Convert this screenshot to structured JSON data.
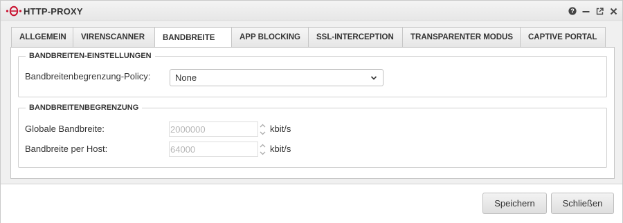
{
  "window": {
    "title": "HTTP-PROXY",
    "icons": [
      "help-icon",
      "minimize-icon",
      "popout-icon",
      "close-icon"
    ],
    "accent": "#c8102e"
  },
  "tabs": [
    {
      "label": "ALLGEMEIN",
      "active": false
    },
    {
      "label": "VIRENSCANNER",
      "active": false
    },
    {
      "label": "BANDBREITE",
      "active": true
    },
    {
      "label": "APP BLOCKING",
      "active": false
    },
    {
      "label": "SSL-INTERCEPTION",
      "active": false
    },
    {
      "label": "TRANSPARENTER MODUS",
      "active": false
    },
    {
      "label": "CAPTIVE PORTAL",
      "active": false
    }
  ],
  "settings": {
    "legend": "BANDBREITEN-EINSTELLUNGEN",
    "policy_label": "Bandbreitenbegrenzung-Policy:",
    "policy_value": "None"
  },
  "limits": {
    "legend": "BANDBREITENBEGRENZUNG",
    "global_label": "Globale Bandbreite:",
    "global_value": "2000000",
    "global_unit": "kbit/s",
    "host_label": "Bandbreite per Host:",
    "host_value": "64000",
    "host_unit": "kbit/s"
  },
  "footer": {
    "save_label": "Speichern",
    "close_label": "Schließen"
  }
}
